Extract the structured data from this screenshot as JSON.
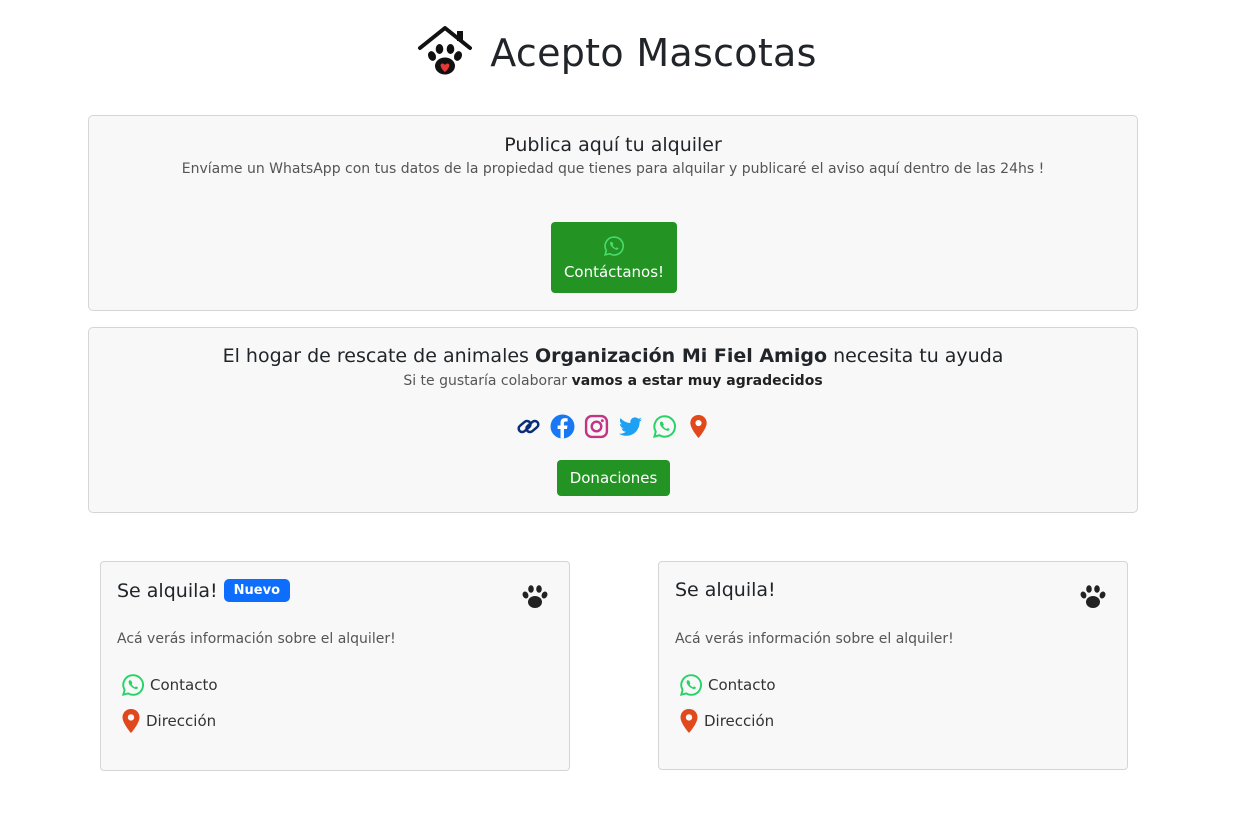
{
  "header": {
    "title": "Acepto Mascotas",
    "logo_icon": "house-paw-heart-icon"
  },
  "publish": {
    "title": "Publica aquí tu alquiler",
    "subtitle": "Envíame un WhatsApp con tus datos de la propiedad que tienes para alquilar y publicaré el aviso aquí dentro de las 24hs !",
    "button_label": "Contáctanos!",
    "button_icon": "whatsapp-icon"
  },
  "rescue": {
    "title_pre": "El hogar de rescate de animales",
    "title_org": "Organización Mi Fiel Amigo",
    "title_post": "necesita tu ayuda",
    "sub_pre": "Si te gustaría colaborar",
    "sub_bold": "vamos a estar muy agradecidos",
    "icons": [
      "link-icon",
      "facebook-icon",
      "instagram-icon",
      "twitter-icon",
      "whatsapp-icon",
      "map-pin-icon"
    ],
    "button_label": "Donaciones"
  },
  "listings": [
    {
      "title": "Se alquila!",
      "badge": "Nuevo",
      "info": "Acá verás información sobre el alquiler!",
      "contact_label": "Contacto",
      "address_label": "Dirección"
    },
    {
      "title": "Se alquila!",
      "badge": "",
      "info": "Acá verás información sobre el alquiler!",
      "contact_label": "Contacto",
      "address_label": "Dirección"
    }
  ],
  "colors": {
    "green_button": "#239323",
    "badge_blue": "#0d6efd",
    "whatsapp": "#25d366",
    "map_pin": "#e0491b",
    "facebook": "#1877f2",
    "instagram": "#c13584",
    "twitter": "#1da1f2",
    "link": "#0b2e7a",
    "panel_bg": "#f8f8f8"
  }
}
